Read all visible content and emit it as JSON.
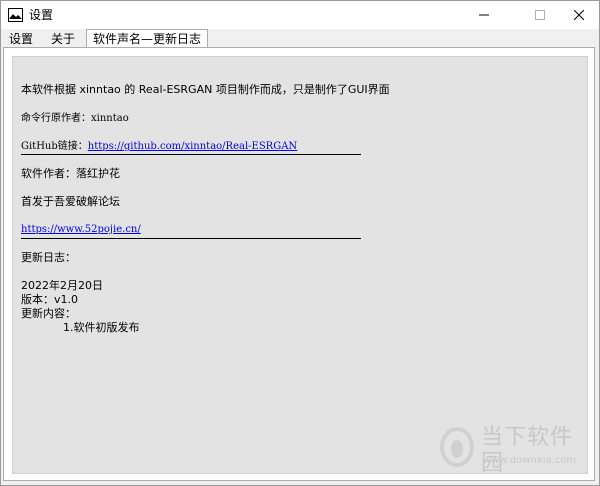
{
  "window": {
    "title": "设置",
    "icon": "image-icon"
  },
  "tabs": [
    {
      "label": "设置",
      "active": false
    },
    {
      "label": "关于",
      "active": false
    },
    {
      "label": "软件声名—更新日志",
      "active": true
    }
  ],
  "content": {
    "intro": "本软件根据 xinntao 的 Real-ESRGAN 项目制作而成，只是制作了GUI界面",
    "cli_author": "命令行原作者：xinntao",
    "github_label": "GitHub链接：",
    "github_url": "https://github.com/xinntao/Real-ESRGAN",
    "software_author": "软件作者：落红护花",
    "first_release": "首发于吾爱破解论坛",
    "forum_url": "https://www.52pojie.cn/",
    "changelog_heading": "更新日志：",
    "date": "2022年2月20日",
    "version": "版本：v1.0",
    "changes_heading": "更新内容：",
    "change_item": "1.软件初版发布"
  },
  "watermark": {
    "name": "当下软件园",
    "url": "www.downxia.com"
  },
  "colors": {
    "link": "#0000ee",
    "content_bg": "#e3e3e3",
    "window_bg": "#f0f0f0"
  }
}
